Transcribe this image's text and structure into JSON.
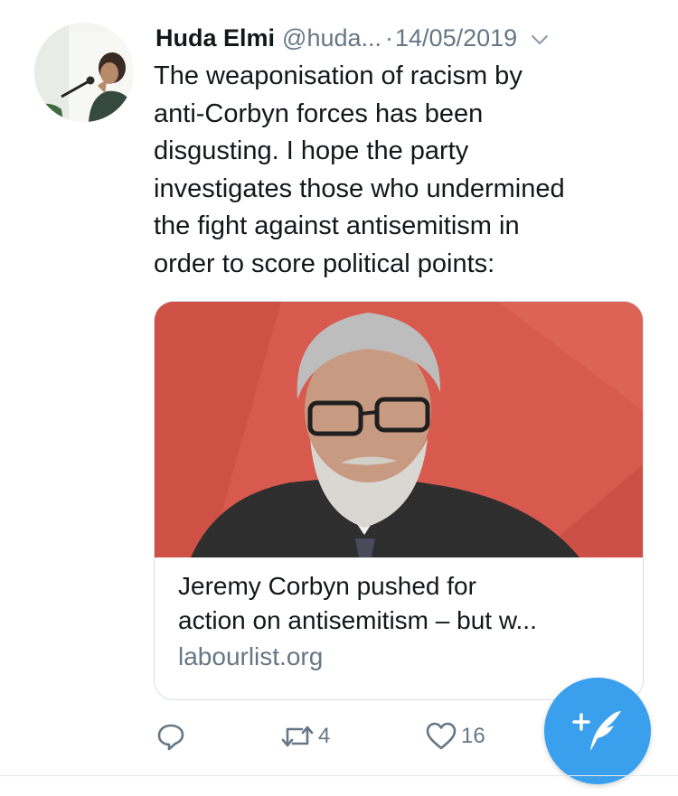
{
  "tweet": {
    "author_name": "Huda Elmi",
    "author_handle": "@huda...",
    "separator": "·",
    "date": "14/05/2019",
    "text_lines": [
      "The weaponisation of racism by",
      "anti-Corbyn forces has been",
      "disgusting. I hope the party",
      "investigates those who undermined",
      "the fight against antisemitism in",
      "order to score political points:"
    ]
  },
  "card": {
    "title_lines": [
      "Jeremy Corbyn pushed for",
      "action on antisemitism – but w..."
    ],
    "domain": "labourlist.org"
  },
  "actions": {
    "retweet_count": "4",
    "like_count": "16"
  },
  "colors": {
    "accent": "#3aa0ee",
    "secondary_text": "#657786",
    "card_image_background": "#d95a50"
  },
  "icons": {
    "caret": "chevron-down-icon",
    "reply": "reply-icon",
    "retweet": "retweet-icon",
    "like": "heart-icon",
    "compose": "compose-tweet-icon"
  }
}
